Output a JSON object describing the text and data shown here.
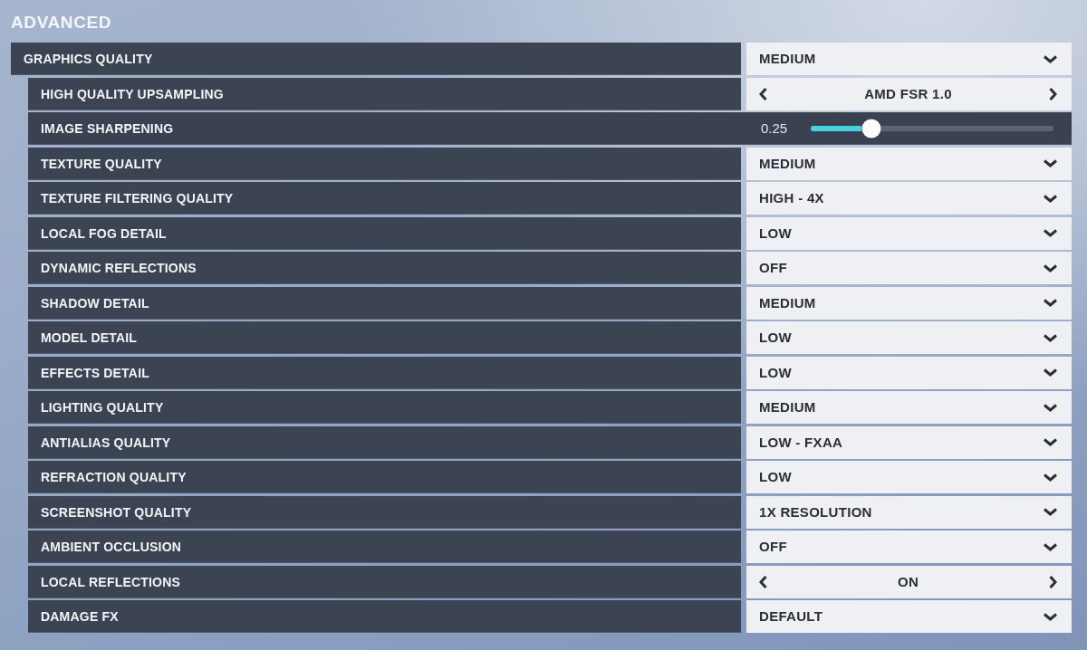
{
  "section_title": "ADVANCED",
  "settings": [
    {
      "label": "GRAPHICS QUALITY",
      "kind": "dropdown",
      "value": "MEDIUM",
      "children": [
        {
          "label": "HIGH QUALITY UPSAMPLING",
          "kind": "stepper",
          "value": "AMD FSR 1.0"
        },
        {
          "label": "IMAGE SHARPENING",
          "kind": "slider",
          "reading": "0.25",
          "level": 0.25
        },
        {
          "label": "TEXTURE QUALITY",
          "kind": "dropdown",
          "value": "MEDIUM"
        },
        {
          "label": "TEXTURE FILTERING QUALITY",
          "kind": "dropdown",
          "value": "HIGH - 4X"
        },
        {
          "label": "LOCAL FOG DETAIL",
          "kind": "dropdown",
          "value": "LOW"
        },
        {
          "label": "DYNAMIC REFLECTIONS",
          "kind": "dropdown",
          "value": "OFF"
        },
        {
          "label": "SHADOW DETAIL",
          "kind": "dropdown",
          "value": "MEDIUM"
        },
        {
          "label": "MODEL DETAIL",
          "kind": "dropdown",
          "value": "LOW"
        },
        {
          "label": "EFFECTS DETAIL",
          "kind": "dropdown",
          "value": "LOW"
        },
        {
          "label": "LIGHTING QUALITY",
          "kind": "dropdown",
          "value": "MEDIUM"
        },
        {
          "label": "ANTIALIAS QUALITY",
          "kind": "dropdown",
          "value": "LOW - FXAA"
        },
        {
          "label": "REFRACTION QUALITY",
          "kind": "dropdown",
          "value": "LOW"
        },
        {
          "label": "SCREENSHOT QUALITY",
          "kind": "dropdown",
          "value": "1X RESOLUTION"
        },
        {
          "label": "AMBIENT OCCLUSION",
          "kind": "dropdown",
          "value": "OFF"
        },
        {
          "label": "LOCAL REFLECTIONS",
          "kind": "stepper",
          "value": "ON"
        },
        {
          "label": "DAMAGE FX",
          "kind": "dropdown",
          "value": "DEFAULT"
        }
      ]
    }
  ]
}
